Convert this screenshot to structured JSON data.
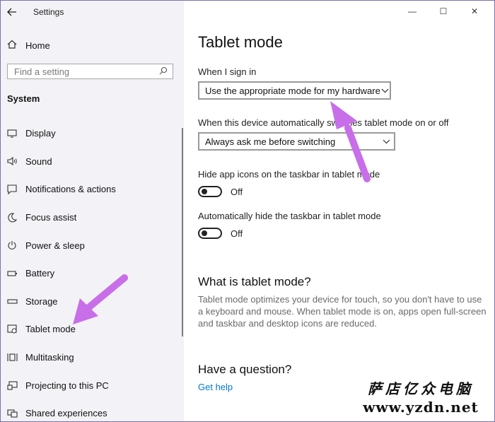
{
  "app": {
    "title": "Settings",
    "back_icon": "back-arrow-icon"
  },
  "sidebar": {
    "home_label": "Home",
    "search_placeholder": "Find a setting",
    "section": "System",
    "items": [
      {
        "label": "Display",
        "icon": "display-icon"
      },
      {
        "label": "Sound",
        "icon": "sound-icon"
      },
      {
        "label": "Notifications & actions",
        "icon": "notification-icon"
      },
      {
        "label": "Focus assist",
        "icon": "moon-icon"
      },
      {
        "label": "Power & sleep",
        "icon": "power-icon"
      },
      {
        "label": "Battery",
        "icon": "battery-icon"
      },
      {
        "label": "Storage",
        "icon": "storage-icon"
      },
      {
        "label": "Tablet mode",
        "icon": "tablet-mode-icon"
      },
      {
        "label": "Multitasking",
        "icon": "multitasking-icon"
      },
      {
        "label": "Projecting to this PC",
        "icon": "projecting-icon"
      },
      {
        "label": "Shared experiences",
        "icon": "shared-experiences-icon"
      }
    ]
  },
  "window_controls": {
    "minimize": "—",
    "maximize": "☐",
    "close": "✕"
  },
  "main": {
    "title": "Tablet mode",
    "signin_label": "When I sign in",
    "signin_value": "Use the appropriate mode for my hardware",
    "switch_label": "When this device automatically switches tablet mode on or off",
    "switch_value": "Always ask me before switching",
    "hide_icons_label": "Hide app icons on the taskbar in tablet mode",
    "hide_icons_state": "Off",
    "hide_taskbar_label": "Automatically hide the taskbar in tablet mode",
    "hide_taskbar_state": "Off",
    "what_title": "What is tablet mode?",
    "what_desc": "Tablet mode optimizes your device for touch, so you don't have to use a keyboard and mouse. When tablet mode is on, apps open full-screen and taskbar and desktop icons are reduced.",
    "question_title": "Have a question?",
    "help_link": "Get help"
  },
  "watermark": {
    "text_cn": "萨店亿众电脑",
    "url": "www.yzdn.net"
  },
  "colors": {
    "accent": "#0078d7",
    "annotation_arrow": "#c86ee8"
  }
}
